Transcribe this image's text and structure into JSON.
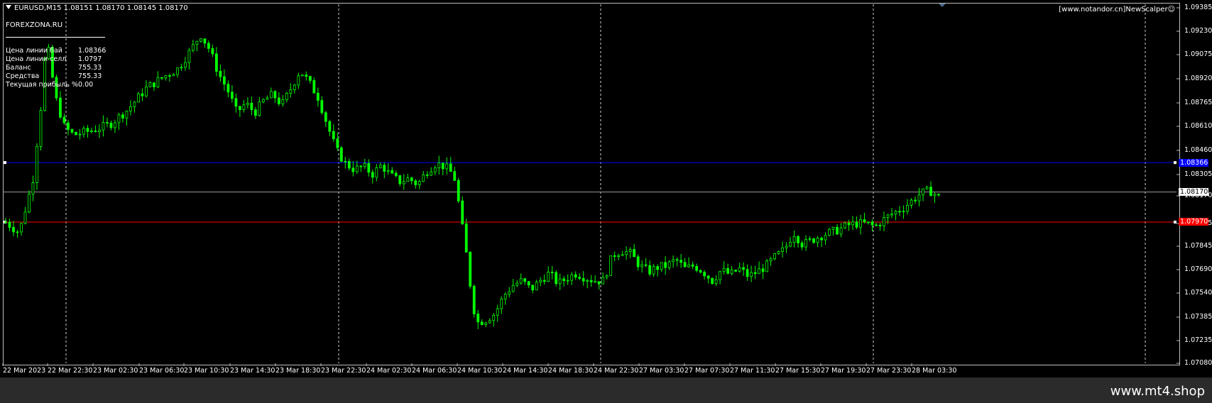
{
  "header": {
    "symbol_ohlc": "EURUSD,M15  1.08151 1.08170 1.08145 1.08170"
  },
  "info_panel": {
    "brand": "FOREXZONA.RU",
    "rows": [
      {
        "label": "Цена линии бай",
        "value": "1.08366"
      },
      {
        "label": "Цена линии селл",
        "value": "1.0797"
      },
      {
        "label": "Баланс",
        "value": "755.33"
      },
      {
        "label": "Средства",
        "value": "755.33"
      },
      {
        "label": "Текущая прибыль %",
        "value": "0.00"
      }
    ]
  },
  "ea_label": "[www.notandor.cn]NewScalper☺",
  "chart_data": {
    "type": "candlestick",
    "symbol": "EURUSD",
    "timeframe": "M15",
    "ylim": [
      1.0703,
      1.0942
    ],
    "y_ticks": [
      "1.09385",
      "1.09230",
      "1.09075",
      "1.08920",
      "1.08765",
      "1.08610",
      "1.08460",
      "1.08305",
      "1.08170",
      "1.07995",
      "1.07845",
      "1.07690",
      "1.07540",
      "1.07385",
      "1.07235",
      "1.07080"
    ],
    "x_ticks": [
      "22 Mar 2023",
      "22 Mar 22:30",
      "23 Mar 02:30",
      "23 Mar 06:30",
      "23 Mar 10:30",
      "23 Mar 14:30",
      "23 Mar 18:30",
      "23 Mar 22:30",
      "24 Mar 02:30",
      "24 Mar 06:30",
      "24 Mar 10:30",
      "24 Mar 14:30",
      "24 Mar 18:30",
      "24 Mar 22:30",
      "27 Mar 03:30",
      "27 Mar 07:30",
      "27 Mar 11:30",
      "27 Mar 15:30",
      "27 Mar 19:30",
      "27 Mar 23:30",
      "28 Mar 03:30"
    ],
    "buy_line": {
      "price": 1.08366,
      "label": "1.08366",
      "color": "#0000ff"
    },
    "sell_line": {
      "price": 1.0797,
      "label": "1.07970",
      "color": "#ff0000"
    },
    "current_line": {
      "price": 1.0817,
      "label": "1.08170",
      "color": "#9a9a9a"
    },
    "candle_color": "#00ff00",
    "grid": false,
    "path": [
      [
        0,
        1.0797
      ],
      [
        3,
        1.079
      ],
      [
        6,
        1.0825
      ],
      [
        8,
        1.088
      ],
      [
        9,
        1.092
      ],
      [
        10,
        1.09
      ],
      [
        11,
        1.088
      ],
      [
        13,
        1.086
      ],
      [
        15,
        1.0855
      ],
      [
        19,
        1.0858
      ],
      [
        23,
        1.0862
      ],
      [
        27,
        1.0872
      ],
      [
        31,
        1.0886
      ],
      [
        35,
        1.0894
      ],
      [
        38,
        1.0899
      ],
      [
        41,
        1.0912
      ],
      [
        43,
        1.0922
      ],
      [
        45,
        1.0912
      ],
      [
        47,
        1.0896
      ],
      [
        49,
        1.0885
      ],
      [
        51,
        1.087
      ],
      [
        53,
        1.0876
      ],
      [
        55,
        1.087
      ],
      [
        57,
        1.0878
      ],
      [
        59,
        1.0882
      ],
      [
        61,
        1.0875
      ],
      [
        63,
        1.0886
      ],
      [
        65,
        1.0898
      ],
      [
        67,
        1.089
      ],
      [
        69,
        1.088
      ],
      [
        71,
        1.0862
      ],
      [
        73,
        1.0845
      ],
      [
        75,
        1.0836
      ],
      [
        77,
        1.0832
      ],
      [
        79,
        1.0834
      ],
      [
        81,
        1.0829
      ],
      [
        83,
        1.0835
      ],
      [
        85,
        1.0828
      ],
      [
        87,
        1.0824
      ],
      [
        89,
        1.0826
      ],
      [
        91,
        1.0822
      ],
      [
        93,
        1.0831
      ],
      [
        95,
        1.0836
      ],
      [
        97,
        1.0834
      ],
      [
        99,
        1.0828
      ],
      [
        100,
        1.081
      ],
      [
        101,
        1.079
      ],
      [
        102,
        1.077
      ],
      [
        103,
        1.0745
      ],
      [
        104,
        1.073
      ],
      [
        106,
        1.0732
      ],
      [
        108,
        1.0736
      ],
      [
        110,
        1.0748
      ],
      [
        112,
        1.0755
      ],
      [
        114,
        1.0758
      ],
      [
        116,
        1.0752
      ],
      [
        118,
        1.0758
      ],
      [
        120,
        1.0763
      ],
      [
        122,
        1.0756
      ],
      [
        124,
        1.076
      ],
      [
        126,
        1.0763
      ],
      [
        128,
        1.076
      ],
      [
        130,
        1.0758
      ],
      [
        132,
        1.0758
      ],
      [
        134,
        1.0775
      ],
      [
        136,
        1.0778
      ],
      [
        138,
        1.0776
      ],
      [
        140,
        1.0768
      ],
      [
        142,
        1.0764
      ],
      [
        144,
        1.0767
      ],
      [
        146,
        1.0768
      ],
      [
        148,
        1.0772
      ],
      [
        150,
        1.0766
      ],
      [
        152,
        1.0768
      ],
      [
        154,
        1.0764
      ],
      [
        156,
        1.0758
      ],
      [
        158,
        1.0765
      ],
      [
        160,
        1.0762
      ],
      [
        162,
        1.0766
      ],
      [
        164,
        1.0761
      ],
      [
        166,
        1.0764
      ],
      [
        168,
        1.0768
      ],
      [
        170,
        1.0774
      ],
      [
        172,
        1.0779
      ],
      [
        174,
        1.079
      ],
      [
        176,
        1.0782
      ],
      [
        178,
        1.0785
      ],
      [
        180,
        1.0788
      ],
      [
        182,
        1.079
      ],
      [
        184,
        1.0792
      ],
      [
        186,
        1.0795
      ],
      [
        188,
        1.0796
      ],
      [
        190,
        1.0796
      ],
      [
        192,
        1.0794
      ],
      [
        194,
        1.0799
      ],
      [
        196,
        1.0803
      ],
      [
        198,
        1.0806
      ],
      [
        200,
        1.0811
      ],
      [
        202,
        1.0816
      ],
      [
        204,
        1.0818
      ],
      [
        206,
        1.0814
      ]
    ]
  },
  "footer": {
    "text": "www.mt4.shop"
  }
}
